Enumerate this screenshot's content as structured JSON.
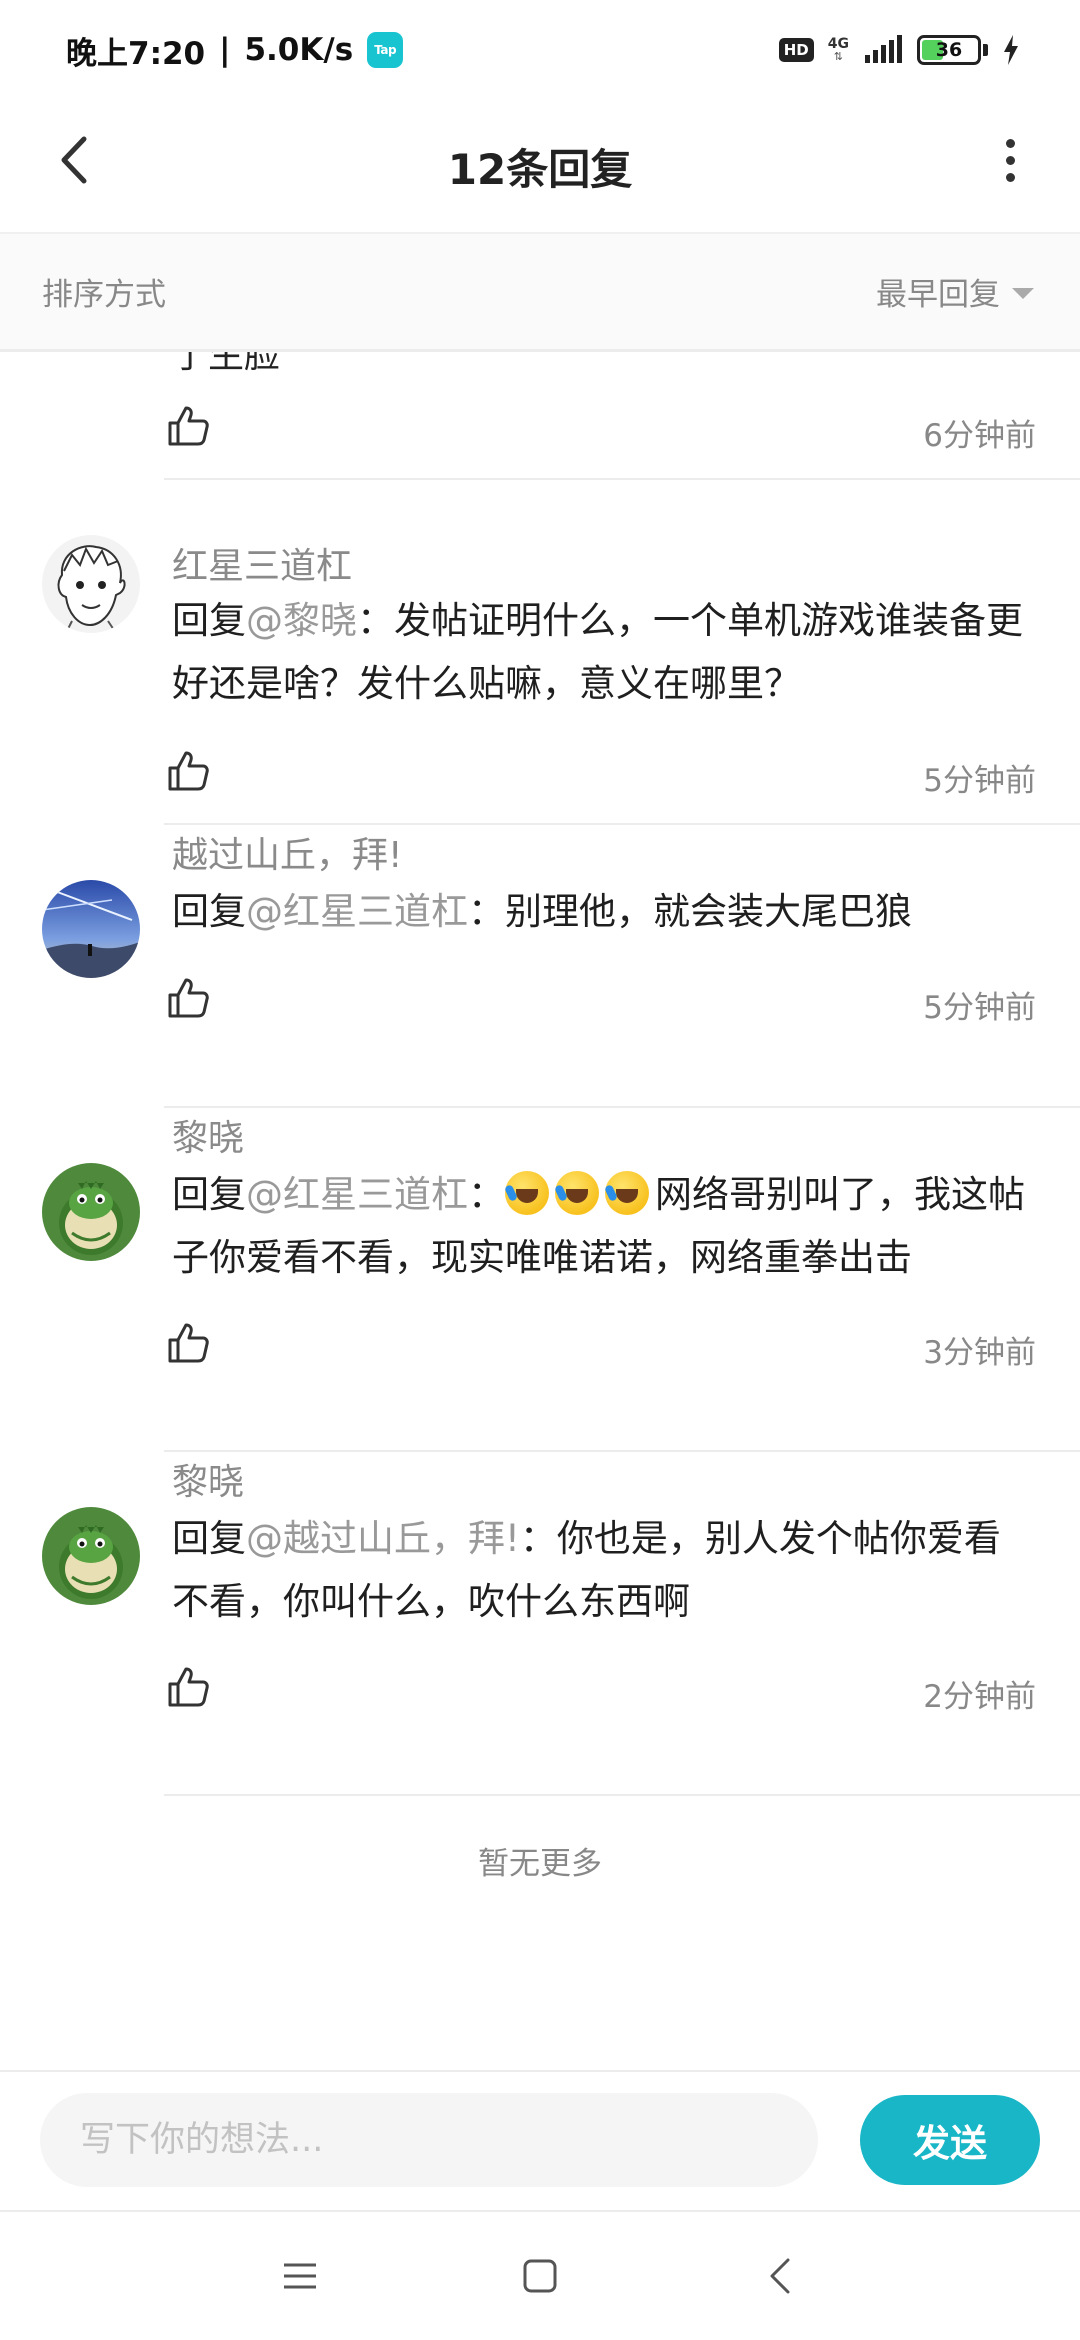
{
  "status_bar": {
    "time": "晚上7:20",
    "speed": "5.0K/s",
    "app_badge": "Tap",
    "hd_label": "HD",
    "network": "4G",
    "battery": "36"
  },
  "header": {
    "title": "12条回复"
  },
  "sort": {
    "label": "排序方式",
    "value": "最早回复"
  },
  "partial_item": {
    "content": "了生脸",
    "time": "6分钟前"
  },
  "replies": [
    {
      "author": "红星三道杠",
      "prefix": "回复",
      "mention": "@黎晓",
      "text": "：发帖证明什么，一个单机游戏谁装备更好还是啥？发什么贴嘛，意义在哪里？",
      "time": "5分钟前"
    },
    {
      "author": "越过山丘，拜!",
      "prefix": "回复",
      "mention": "@红星三道杠",
      "text": "：别理他，就会装大尾巴狼",
      "time": "5分钟前"
    },
    {
      "author": "黎晓",
      "prefix": "回复",
      "mention": "@红星三道杠",
      "text": "网络哥别叫了，我这帖子你爱看不看，现实唯唯诺诺，网络重拳出击",
      "time": "3分钟前"
    },
    {
      "author": "黎晓",
      "prefix": "回复",
      "mention": "@越过山丘，拜!",
      "text": "：你也是，别人发个帖你爱看不看，你叫什么，吹什么东西啊",
      "time": "2分钟前"
    }
  ],
  "footer": {
    "no_more": "暂无更多"
  },
  "composer": {
    "placeholder": "写下你的想法...",
    "send_label": "发送"
  },
  "colors": {
    "accent": "#18b6c6",
    "muted_text": "#888888",
    "mention": "#999999"
  }
}
